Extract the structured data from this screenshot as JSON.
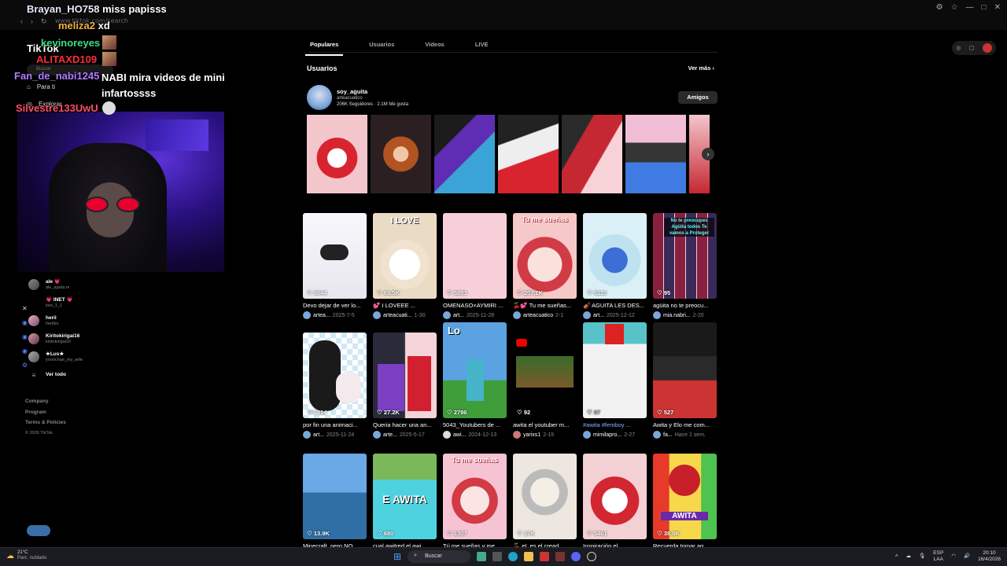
{
  "browser": {
    "url": "www.tiktok.com/search",
    "window_controls": [
      "—",
      "□",
      "✕"
    ]
  },
  "chat_overlay": [
    {
      "user": "Brayan_HO758",
      "user_color": "#e8e8ff",
      "message": "miss papisss"
    },
    {
      "user": "meliza2",
      "user_color": "#f0b040",
      "message": "xd"
    },
    {
      "user": "kevinoreyes",
      "user_color": "#3ddc84",
      "message": ""
    },
    {
      "user": "ALITAXD109",
      "user_color": "#ff2a3a",
      "message": ""
    },
    {
      "user": "Fan_de_nabi1245",
      "user_color": "#b07cff",
      "message": "NABI mira videos de mini infartossss"
    },
    {
      "user": "Silvestre133UwU",
      "user_color": "#ff4d6a",
      "message": ""
    }
  ],
  "sidebar": {
    "logo": "TikTok",
    "search_placeholder": "Buscar",
    "nav": [
      {
        "label": "Para ti",
        "icon": "home-icon"
      },
      {
        "label": "Explorar",
        "icon": "compass-icon"
      }
    ],
    "following": [
      {
        "name": "ale 💗",
        "handle": "ale_apata.m"
      },
      {
        "name": "💗 INET 💗",
        "handle": "inet_1_1"
      },
      {
        "name": "herii",
        "handle": "heriibo"
      },
      {
        "name": "Kiritokirigai16",
        "handle": "kiritokirigai16"
      },
      {
        "name": "★Lus★",
        "handle": "yoonchae_my_wife"
      }
    ],
    "see_all": "Ver todo",
    "footer": [
      "Company",
      "Program",
      "Terms & Policies",
      "© 2026 TikTok"
    ]
  },
  "main": {
    "tabs": [
      "Populares",
      "Usuarios",
      "Videos",
      "LIVE"
    ],
    "section_title": "Usuarios",
    "see_more": "Ver más",
    "user": {
      "name": "soy_aguita",
      "handle": "arteacuatico",
      "stats": "206K Seguidores · 2.1M Me gusta",
      "button": "Amigos"
    },
    "grid_rows": [
      [
        {
          "likes": "6644",
          "caption": "Devo dejar de ver lo...",
          "author": "artea...",
          "date": "2025-7-5"
        },
        {
          "likes": "69.5K",
          "caption": "💕 I LOVEEE ...",
          "author": "arteacuati...",
          "date": "1-30"
        },
        {
          "likes": "5893",
          "caption": "OMENASO×AYMIRI ...",
          "author": "art...",
          "date": "2025-11-28"
        },
        {
          "likes": "207.1K",
          "caption": "🍒💕 Tu me sueñas...",
          "author": "arteacuatico",
          "date": "2-1"
        },
        {
          "likes": "5110",
          "caption": "🎻 AGUITA LES DES...",
          "author": "art...",
          "date": "2025-12-12"
        },
        {
          "likes": "95",
          "caption": "agüita no te preocu...",
          "author": "mia.nabri...",
          "date": "2-20"
        }
      ],
      [
        {
          "likes": "6814",
          "caption": "por fin una animaci...",
          "author": "art...",
          "date": "2025-11-24"
        },
        {
          "likes": "27.2K",
          "caption": "Queria hacer una an...",
          "author": "arte...",
          "date": "2025-5-17"
        },
        {
          "likes": "2796",
          "caption": "5043_Youtubers de ...",
          "author": "awi...",
          "date": "2024-12-13"
        },
        {
          "likes": "92",
          "caption": "awita el youtuber m...",
          "author": "yarixs1",
          "date": "2-15"
        },
        {
          "likes": "87",
          "caption": "#awita #femboy ...",
          "author": "mimilapro...",
          "date": "2-27"
        },
        {
          "likes": "527",
          "caption": "Awita y Elo me com...",
          "author": "fa...",
          "date": "Hace 1 sem."
        }
      ],
      [
        {
          "likes": "13.9K",
          "caption": "Minecraft, pero NO...",
          "author": "",
          "date": ""
        },
        {
          "likes": "680",
          "caption": "cual awitred el awi...",
          "author": "",
          "date": ""
        },
        {
          "likes": "1307",
          "caption": "Tú me sueñas y me...",
          "author": "",
          "date": ""
        },
        {
          "likes": "17K",
          "caption": "🍒 eL es el cread...",
          "author": "",
          "date": ""
        },
        {
          "likes": "5461",
          "caption": "Inspiración el...",
          "author": "",
          "date": ""
        },
        {
          "likes": "38.8K",
          "caption": "Recuerda tomar ag...",
          "author": "",
          "date": ""
        }
      ]
    ],
    "thumb_texts": {
      "r0c1": "I LOVE",
      "r0c3": "Tu me sueñas",
      "r1c2": "Lo",
      "r2c1": "E AWITA",
      "r2c2": "Tu me sueñas",
      "r2c5": "AWITA",
      "r0c5": "No te preocupes Agüita todos Te vamos a Proteger"
    }
  },
  "taskbar": {
    "weather_temp": "21°C",
    "weather_desc": "Parc. nublado",
    "search": "Buscar",
    "lang": "ESP",
    "lang2": "LAA",
    "time": "20:10",
    "date": "16/4/2026"
  },
  "colors": {
    "bg": "#000000",
    "accent": "#fe2c55"
  }
}
